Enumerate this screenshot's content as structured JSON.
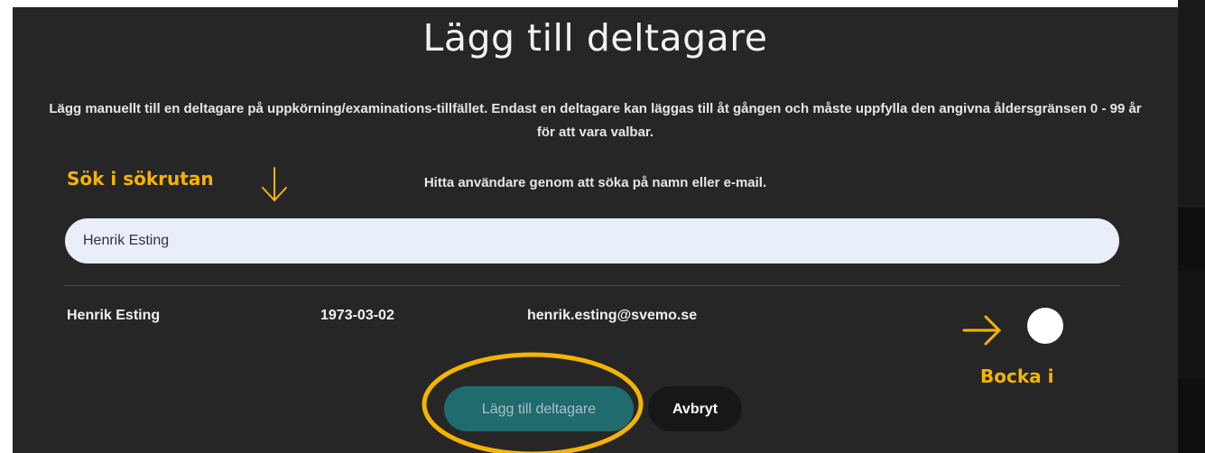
{
  "dialog": {
    "title": "Lägg till deltagare",
    "description": "Lägg manuellt till en deltagare på uppkörning/examinations-tillfället. Endast en deltagare kan läggas till åt gången och måste uppfylla den angivna åldersgränsen 0 - 99 år för att vara valbar.",
    "search_hint": "Hitta användare genom att söka på namn eller e-mail.",
    "search_value": "Henrik Esting"
  },
  "results": [
    {
      "name": "Henrik Esting",
      "birthdate": "1973-03-02",
      "email": "henrik.esting@svemo.se",
      "selected": false
    }
  ],
  "buttons": {
    "add_label": "Lägg till deltagare",
    "cancel_label": "Avbryt"
  },
  "annotations": {
    "search_note": "Sök i sökrutan",
    "check_note": "Bocka i",
    "color": "#f6b400"
  },
  "colors": {
    "modal_bg": "#262626",
    "search_bg": "#e9effa",
    "primary_button": "#1f6b6e"
  }
}
